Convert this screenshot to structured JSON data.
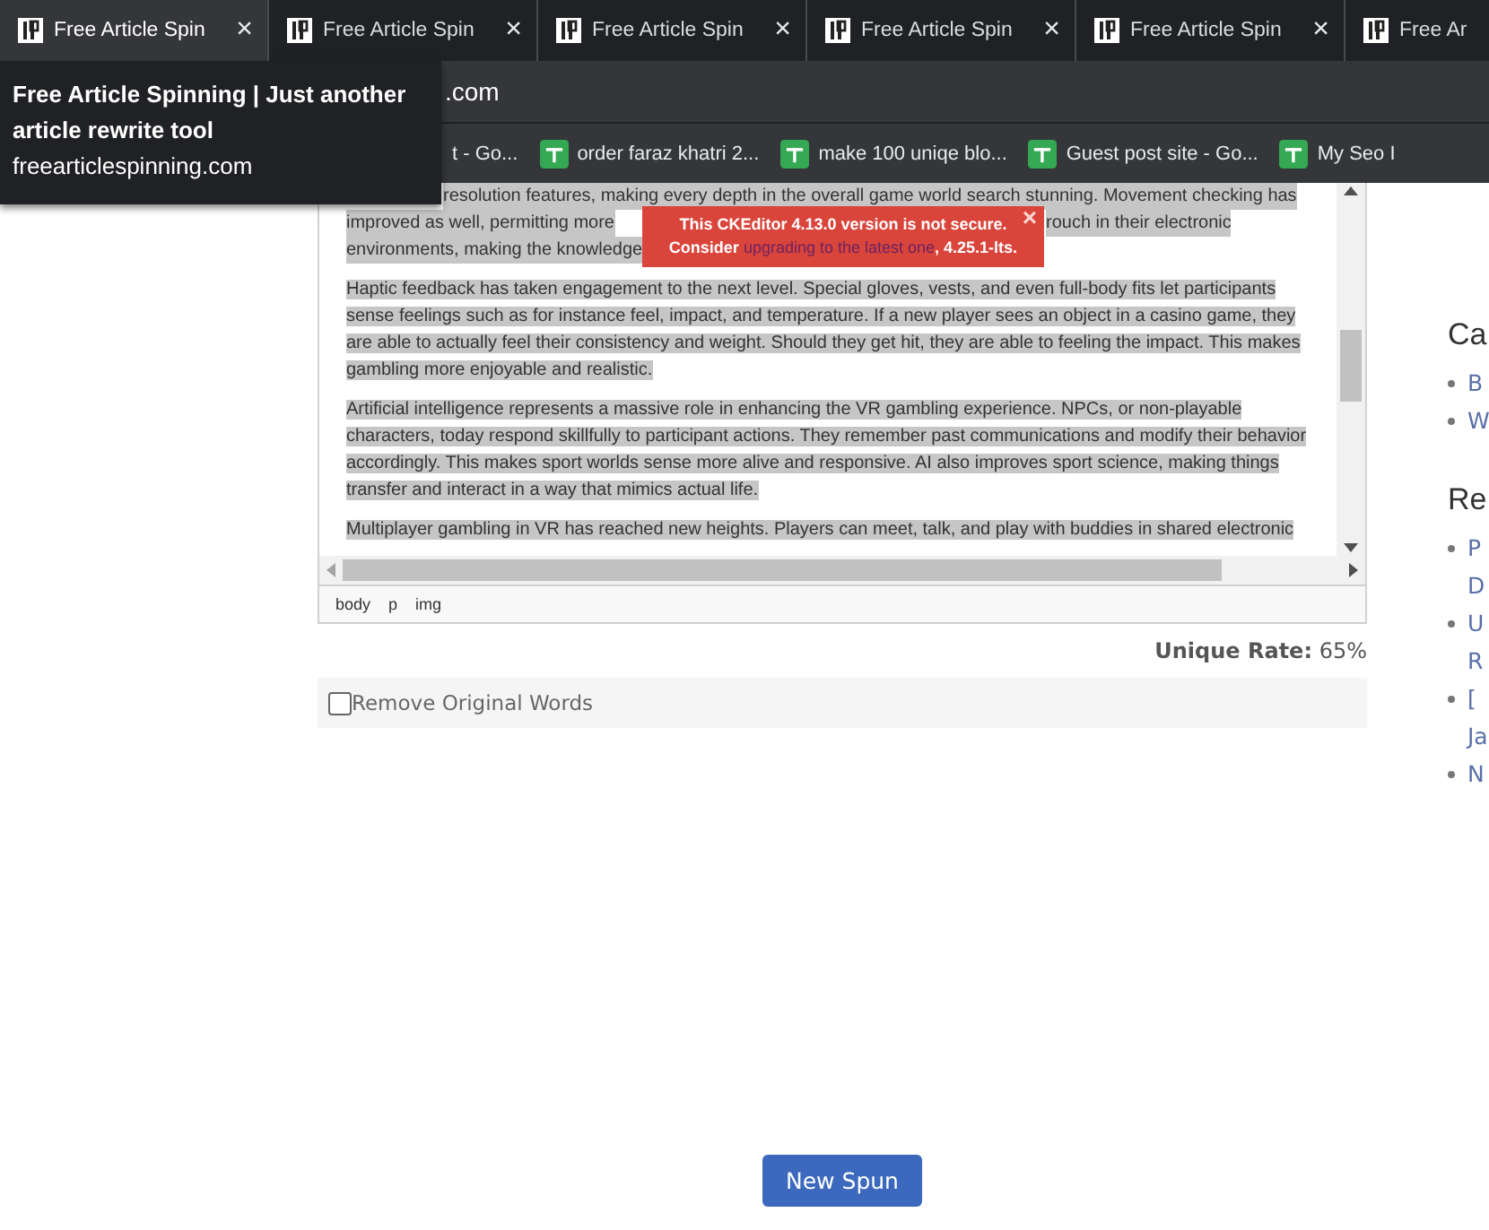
{
  "tabs": [
    {
      "title": "Free Article Spin",
      "selected": true
    },
    {
      "title": "Free Article Spin",
      "selected": false
    },
    {
      "title": "Free Article Spin",
      "selected": false
    },
    {
      "title": "Free Article Spin",
      "selected": false
    },
    {
      "title": "Free Article Spin",
      "selected": false
    },
    {
      "title": "Free Ar",
      "selected": false
    }
  ],
  "tab_close": "×",
  "address_bar": {
    "value": ".com"
  },
  "bookmarks": [
    {
      "label": "t - Go...",
      "icon": false
    },
    {
      "label": "order faraz khatri 2...",
      "icon": true
    },
    {
      "label": "make 100 uniqe blo...",
      "icon": true
    },
    {
      "label": "Guest post site - Go...",
      "icon": true
    },
    {
      "label": "My Seo I",
      "icon": true
    }
  ],
  "tooltip": {
    "title": "Free Article Spinning | Just another article rewrite tool",
    "url": "freearticlespinning.com"
  },
  "editor": {
    "partial_lines": [
      [
        "resolution features, making every depth in the overall game world search stunning. Movement checking has"
      ],
      [
        "improved as well, permitting more",
        "rouch in their electronic"
      ],
      [
        "environments, making the knowledge"
      ]
    ],
    "paragraphs": [
      "Haptic feedback has taken engagement to the next level. Special gloves, vests, and even full-body fits let participants sense feelings such as for instance feel, impact, and temperature. If a new player sees an object in a casino game, they are able to actually feel their consistency and weight. Should they get hit, they are able to feeling the impact. This makes gambling more enjoyable and realistic.",
      "Artificial intelligence represents a massive role in enhancing the VR gambling experience. NPCs, or non-playable characters, today respond skillfully to participant actions. They remember past communications and modify their behavior accordingly. This makes sport worlds sense more alive and responsive. AI also improves sport science, making things transfer and interact in a way that mimics actual life.",
      "Multiplayer gambling in VR has reached new heights. Players can meet, talk, and play with buddies in shared electronic"
    ],
    "path": [
      "body",
      "p",
      "img"
    ]
  },
  "notification": {
    "before": "This CKEditor 4.13.0 version is not secure. Consider ",
    "link": "upgrading to the latest one",
    "after": ", 4.25.1-lts.",
    "close": "×"
  },
  "unique_rate": "**Unique Rate:** 65%",
  "remove_original": {
    "label": "Remove Original Words",
    "checked": false
  },
  "new_spun_button": "New Spun",
  "sidebar": [
    {
      "heading": "Ca",
      "items": [
        "B",
        "W"
      ]
    },
    {
      "heading": "Re",
      "items": [
        "P D",
        "U R",
        "[ Ja",
        "N"
      ]
    }
  ]
}
